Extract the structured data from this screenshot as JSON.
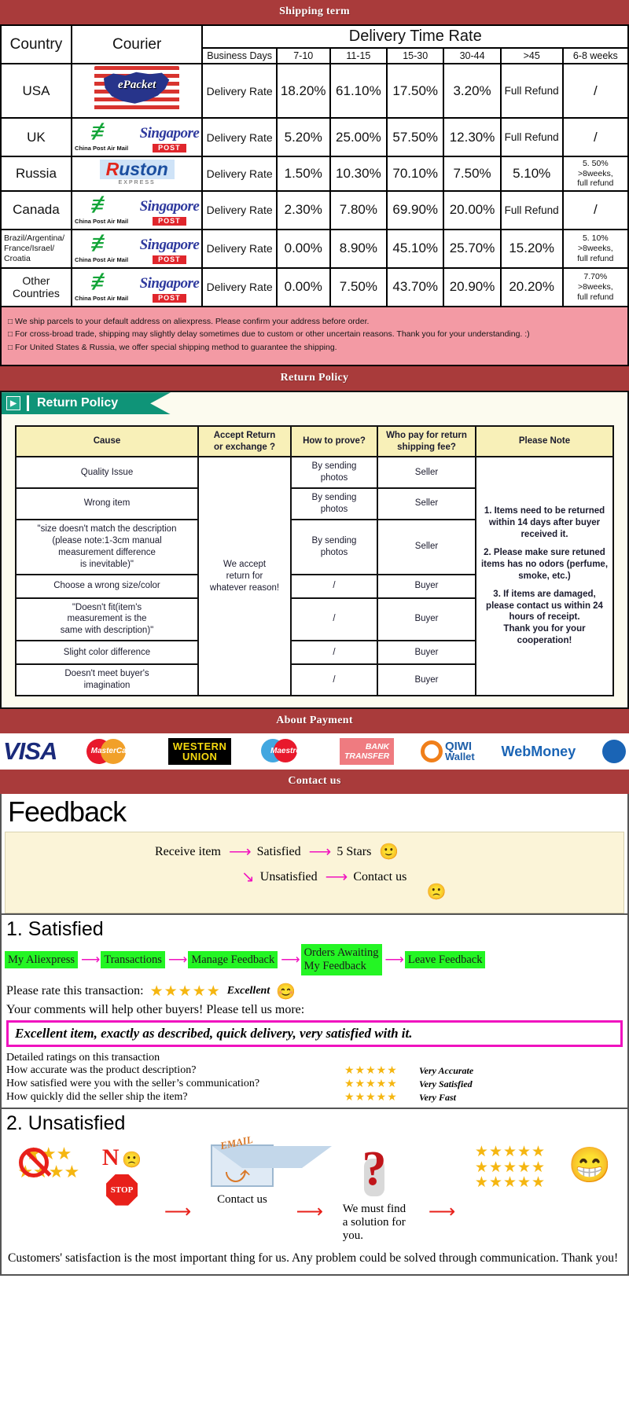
{
  "banners": {
    "shipping": "Shipping term",
    "return": "Return Policy",
    "payment": "About Payment",
    "contact": "Contact us"
  },
  "shipping": {
    "headers": {
      "country": "Country",
      "courier": "Courier",
      "delivery_time_rate": "Delivery Time Rate",
      "business_days": "Business Days",
      "ranges": [
        "7-10",
        "11-15",
        "15-30",
        "30-44",
        ">45",
        "6-8 weeks"
      ]
    },
    "rows": [
      {
        "country": "USA",
        "couriers": [
          "epacket-logo"
        ],
        "label": "Delivery Rate",
        "values": [
          "18.20%",
          "61.10%",
          "17.50%",
          "3.20%",
          "Full Refund",
          "/"
        ]
      },
      {
        "country": "UK",
        "couriers": [
          "china-post-air-mail-logo",
          "singapore-post-logo"
        ],
        "label": "Delivery Rate",
        "values": [
          "5.20%",
          "25.00%",
          "57.50%",
          "12.30%",
          "Full Refund",
          "/"
        ]
      },
      {
        "country": "Russia",
        "couriers": [
          "ruston-express-logo"
        ],
        "label": "Delivery Rate",
        "values": [
          "1.50%",
          "10.30%",
          "70.10%",
          "7.50%",
          "5.10%",
          "5. 50%\n>8weeks,\nfull refund"
        ]
      },
      {
        "country": "Canada",
        "couriers": [
          "china-post-air-mail-logo",
          "singapore-post-logo"
        ],
        "label": "Delivery Rate",
        "values": [
          "2.30%",
          "7.80%",
          "69.90%",
          "20.00%",
          "Full Refund",
          "/"
        ]
      },
      {
        "country": "Brazil/Argentina/\nFrance/Israel/\nCroatia",
        "couriers": [
          "china-post-air-mail-logo",
          "singapore-post-logo"
        ],
        "label": "Delivery Rate",
        "values": [
          "0.00%",
          "8.90%",
          "45.10%",
          "25.70%",
          "15.20%",
          "5. 10%\n>8weeks,\nfull refund"
        ]
      },
      {
        "country": "Other Countries",
        "couriers": [
          "china-post-air-mail-logo",
          "singapore-post-logo"
        ],
        "label": "Delivery Rate",
        "values": [
          "0.00%",
          "7.50%",
          "43.70%",
          "20.90%",
          "20.20%",
          "7.70%\n>8weeks,\nfull refund"
        ]
      }
    ],
    "notes": [
      "We ship parcels to your default address on aliexpress. Please confirm your address before order.",
      "For cross-broad trade, shipping may slightly delay sometimes due to custom or other uncertain reasons. Thank you for your understanding. :)",
      "For United States & Russia, we offer special shipping method to guarantee the shipping."
    ]
  },
  "return_policy": {
    "tab_label": "Return Policy",
    "headers": [
      "Cause",
      "Accept Return\nor exchange ?",
      "How to prove?",
      "Who pay for return\nshipping fee?",
      "Please Note"
    ],
    "accept_cell": "We accept\nreturn for\nwhatever reason!",
    "rows": [
      {
        "cause": "Quality Issue",
        "prove": "By sending\nphotos",
        "who_pays": "Seller"
      },
      {
        "cause": "Wrong item",
        "prove": "By sending\nphotos",
        "who_pays": "Seller"
      },
      {
        "cause": "\"size doesn't match the description\n(please note:1-3cm manual\nmeasurement difference\nis inevitable)\"",
        "prove": "By sending\nphotos",
        "who_pays": "Seller"
      },
      {
        "cause": "Choose a wrong size/color",
        "prove": "/",
        "who_pays": "Buyer"
      },
      {
        "cause": "\"Doesn't fit(item's\nmeasurement is the\nsame with description)\"",
        "prove": "/",
        "who_pays": "Buyer"
      },
      {
        "cause": "Slight color difference",
        "prove": "/",
        "who_pays": "Buyer"
      },
      {
        "cause": "Doesn't meet buyer's\nimagination",
        "prove": "/",
        "who_pays": "Buyer"
      }
    ],
    "notes": [
      "1. Items need to be returned within 14 days after buyer received it.",
      "2. Please make sure retuned items has no odors (perfume, smoke, etc.)",
      "3. If items are damaged, please contact us within 24 hours of receipt.",
      "Thank you for your cooperation!"
    ]
  },
  "payment": {
    "methods": [
      {
        "name": "visa-logo",
        "label": "VISA"
      },
      {
        "name": "mastercard-logo",
        "label": "MasterCard"
      },
      {
        "name": "western-union-logo",
        "label_top": "WESTERN",
        "label_bottom": "UNION"
      },
      {
        "name": "maestro-logo",
        "label": "Maestro"
      },
      {
        "name": "bank-transfer-logo",
        "label_top": "BANK",
        "label_bottom": "TRANSFER"
      },
      {
        "name": "qiwi-wallet-logo",
        "label_top": "QIWI",
        "label_bottom": "Wallet"
      },
      {
        "name": "webmoney-logo",
        "label": "WebMoney"
      },
      {
        "name": "globe-logo",
        "label": ""
      }
    ]
  },
  "feedback": {
    "title": "Feedback",
    "flow": {
      "receive": "Receive item",
      "satisfied": "Satisfied",
      "five_stars": "5 Stars",
      "unsatisfied": "Unsatisfied",
      "contact_us": "Contact us",
      "happy_face": "🙂",
      "sad_face": "🙁"
    },
    "section1_title": "1. Satisfied",
    "steps": [
      "My Aliexpress",
      "Transactions",
      "Manage Feedback",
      "Orders Awaiting\nMy Feedback",
      "Leave Feedback"
    ],
    "rate_label": "Please rate this transaction:",
    "rate_stars": "★★★★★",
    "rate_value": "Excellent",
    "rate_face": "😊",
    "comments_prompt": "Your comments will help other buyers! Please tell us more:",
    "comment_text": "Excellent item, exactly as described, quick delivery, very satisfied with it.",
    "detail_head": "Detailed ratings on this transaction",
    "details": [
      {
        "question": "How accurate was the product description?",
        "stars": "★★★★★",
        "value": "Very Accurate"
      },
      {
        "question": "How satisfied were you with the seller’s communication?",
        "stars": "★★★★★",
        "value": "Very Satisfied"
      },
      {
        "question": "How quickly did the seller ship the item?",
        "stars": "★★★★★",
        "value": "Very Fast"
      }
    ],
    "section2_title": "2. Unsatisfied",
    "unsat": {
      "no_text": "N",
      "stop_text": "STOP",
      "email_text": "EMAIL",
      "contact_caption": "Contact us",
      "solution_caption": "We must find\na solution for\nyou.",
      "good_stars": "★★★★★",
      "final_face": "😁"
    },
    "closing": "Customers' satisfaction is the most important thing for us. Any problem could be solved through communication. Thank you!"
  },
  "colors": {
    "banner_red": "#a93b3b",
    "header_yellow": "#f3eda4",
    "country_purple": "#b9b4d8",
    "note_pink": "#f39aa4",
    "tab_green": "#0f9478",
    "step_green": "#24f524",
    "magenta": "#f012bf",
    "star_gold": "#f5b611"
  }
}
